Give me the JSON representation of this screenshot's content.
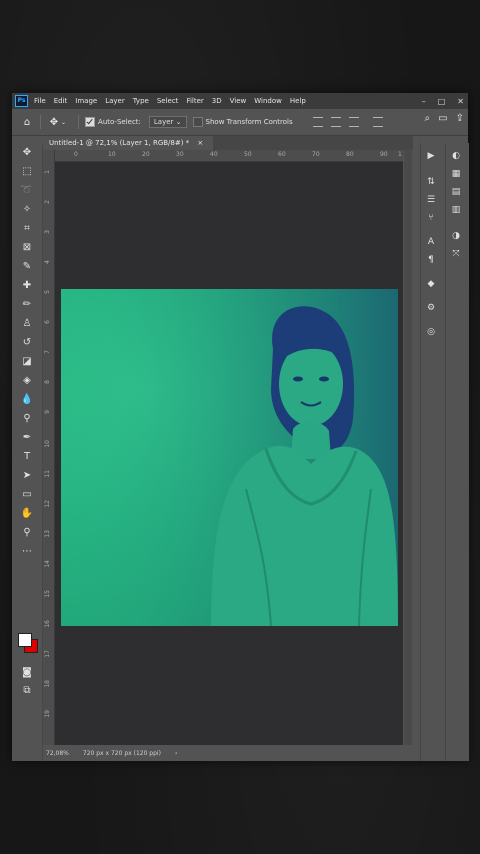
{
  "menubar": {
    "logo": "Ps",
    "items": [
      "File",
      "Edit",
      "Image",
      "Layer",
      "Type",
      "Select",
      "Filter",
      "3D",
      "View",
      "Window",
      "Help"
    ],
    "window_controls": [
      "–",
      "□",
      "✕"
    ]
  },
  "options": {
    "auto_select_label": "Auto-Select:",
    "auto_select_value": "Layer",
    "show_transform_label": "Show Transform Controls"
  },
  "document": {
    "tab_title": "Untitled-1 @ 72,1% (Layer 1, RGB/8#) *",
    "tab_close": "×"
  },
  "rulers": {
    "h_ticks": [
      "0",
      "10",
      "20",
      "30",
      "40",
      "50",
      "60",
      "70",
      "80",
      "90",
      "1"
    ],
    "v_ticks": [
      "1",
      "2",
      "3",
      "4",
      "5",
      "6",
      "7",
      "8",
      "9",
      "10",
      "11",
      "12",
      "13",
      "14",
      "15",
      "16",
      "17",
      "18",
      "19"
    ]
  },
  "status": {
    "zoom": "72,08%",
    "doc_info": "720 px x 720 px (120 ppi)",
    "arrow": "›"
  },
  "colors": {
    "foreground": "#ffffff",
    "background": "#e00000",
    "image_green": "#26b382",
    "image_navy": "#1d3d7a"
  },
  "icons": {
    "home": "home-icon",
    "move": "move-icon",
    "search": "search-icon",
    "share": "share-icon"
  }
}
